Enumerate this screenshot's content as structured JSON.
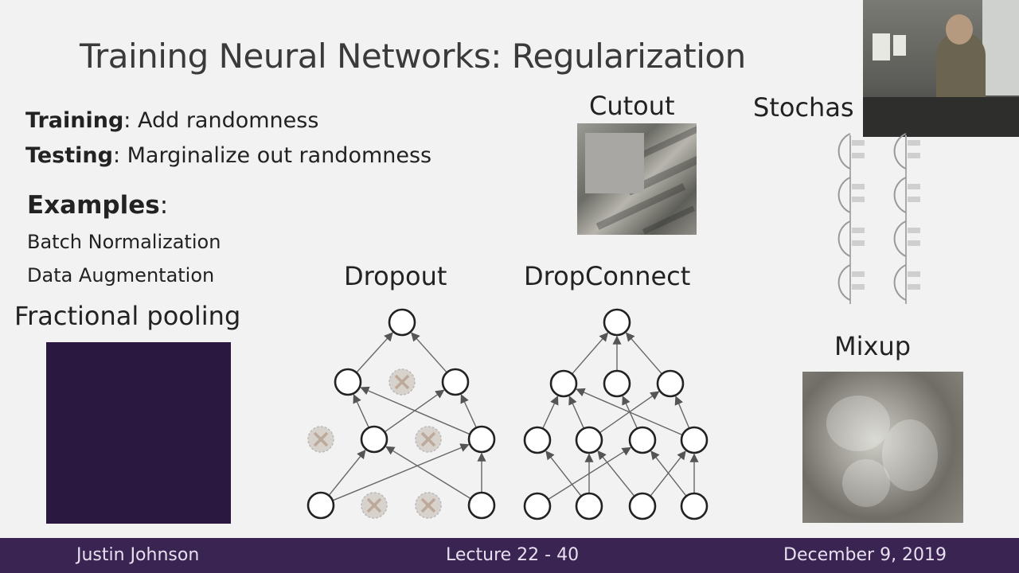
{
  "slide": {
    "title": "Training Neural Networks: Regularization",
    "bullets": [
      {
        "term": "Training",
        "text": ": Add randomness"
      },
      {
        "term": "Testing",
        "text": ": Marginalize out randomness"
      }
    ],
    "examples_term": "Examples",
    "examples_suffix": ":",
    "examples": [
      "Batch Normalization",
      "Data Augmentation"
    ],
    "labels": {
      "fractional": "Fractional pooling",
      "dropout": "Dropout",
      "dropconnect": "DropConnect",
      "cutout": "Cutout",
      "stochastic": "Stochas",
      "mixup": "Mixup"
    }
  },
  "footer": {
    "author": "Justin Johnson",
    "lecture": "Lecture 22 - 40",
    "date": "December 9, 2019"
  },
  "colors": {
    "footer_bg": "#3a2452",
    "dropped_node": "#d8d2cc",
    "dropped_x": "#bca99a"
  }
}
